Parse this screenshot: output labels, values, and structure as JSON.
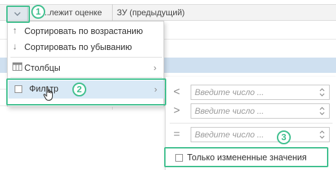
{
  "grid": {
    "columns": [
      {
        "label": "..лежит оценке"
      },
      {
        "label": "ЗУ (предыдущий)"
      }
    ]
  },
  "menu": {
    "items": [
      {
        "id": "sort-asc",
        "label": "Сортировать по возрастанию",
        "icon": "arrow-up-icon"
      },
      {
        "id": "sort-desc",
        "label": "Сортировать по убыванию",
        "icon": "arrow-down-icon"
      },
      {
        "id": "columns",
        "label": "Столбцы",
        "icon": "columns-icon",
        "has_submenu": true
      },
      {
        "id": "filter",
        "label": "Фильтр",
        "icon": "checkbox",
        "has_submenu": true,
        "checked": false
      }
    ]
  },
  "filter_submenu": {
    "conditions": [
      {
        "operator": "<",
        "placeholder": "Введите число ..."
      },
      {
        "operator": ">",
        "placeholder": "Введите число ..."
      },
      {
        "operator": "=",
        "placeholder": "Введите число ..."
      }
    ],
    "only_changed": {
      "label": "Только измененные значения",
      "checked": false
    }
  },
  "callouts": [
    "1",
    "2",
    "3"
  ],
  "colors": {
    "highlight": "#3fbf8e",
    "selection": "#cfe0f0",
    "menu_hover": "#d9e9f6"
  }
}
